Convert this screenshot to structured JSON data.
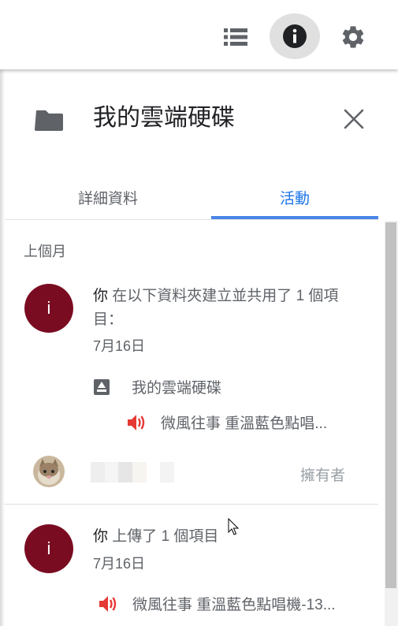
{
  "toolbar": {
    "list_view_icon": "list-view-icon",
    "info_icon": "info-icon",
    "settings_icon": "gear-icon"
  },
  "panel": {
    "title": "我的雲端硬碟",
    "tabs": [
      {
        "label": "詳細資料",
        "active": false
      },
      {
        "label": "活動",
        "active": true
      }
    ]
  },
  "activity": {
    "section_label": "上個月",
    "entries": [
      {
        "avatar_letter": "i",
        "actor": "你",
        "action": " 在以下資料夾建立並共用了 1 個項目：",
        "date": "7月16日",
        "folder_name": "我的雲端硬碟",
        "file_name": "微風往事 重溫藍色點唱...",
        "owner_role": "擁有者"
      },
      {
        "avatar_letter": "i",
        "actor": "你",
        "action": " 上傳了 1 個項目",
        "date": "7月16日",
        "file_name": "微風往事 重溫藍色點唱機-13..."
      }
    ]
  },
  "colors": {
    "accent": "#4a86e8",
    "avatar_bg": "#7a0c22",
    "audio_icon": "#e53935"
  }
}
